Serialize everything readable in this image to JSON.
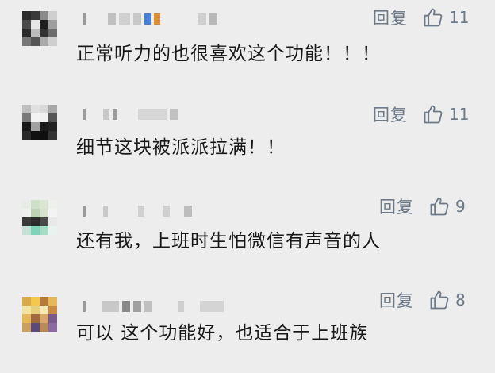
{
  "comments": [
    {
      "text": "正常听力的也很喜欢这个功能！！！",
      "reply_label": "回复",
      "likes": "11"
    },
    {
      "text": "细节这块被派派拉满！！",
      "reply_label": "回复",
      "likes": "11"
    },
    {
      "text": "还有我，上班时生怕微信有声音的人",
      "reply_label": "回复",
      "likes": "9"
    },
    {
      "text": "可以 这个功能好，也适合于上班族",
      "reply_label": "回复",
      "likes": "8"
    }
  ],
  "colors": {
    "background": "#ededed",
    "action": "#6d7a8a",
    "text": "#191919"
  },
  "icons": {
    "like": "thumbs-up-icon"
  }
}
